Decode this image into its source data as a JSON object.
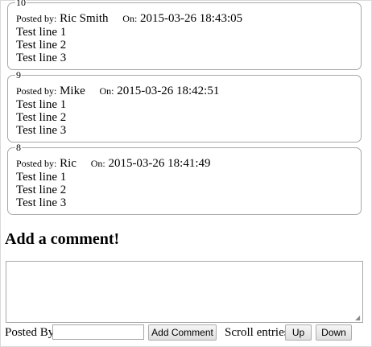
{
  "comments": [
    {
      "number": "10",
      "posted_by_label": "Posted by:",
      "author": "Ric Smith",
      "on_label": "On:",
      "timestamp": "2015-03-26 18:43:05",
      "lines": [
        "Test line 1",
        "Test line 2",
        "Test line 3"
      ]
    },
    {
      "number": "9",
      "posted_by_label": "Posted by:",
      "author": "Mike",
      "on_label": "On:",
      "timestamp": "2015-03-26 18:42:51",
      "lines": [
        "Test line 1",
        "Test line 2",
        "Test line 3"
      ]
    },
    {
      "number": "8",
      "posted_by_label": "Posted by:",
      "author": "Ric",
      "on_label": "On:",
      "timestamp": "2015-03-26 18:41:49",
      "lines": [
        "Test line 1",
        "Test line 2",
        "Test line 3"
      ]
    }
  ],
  "form": {
    "heading": "Add a comment!",
    "comment_value": "",
    "posted_by_label": "Posted By:",
    "name_value": "",
    "add_button": "Add Comment",
    "scroll_label": "Scroll entries:",
    "up_button": "Up",
    "down_button": "Down",
    "resize_icon": "resize-grip-icon"
  }
}
